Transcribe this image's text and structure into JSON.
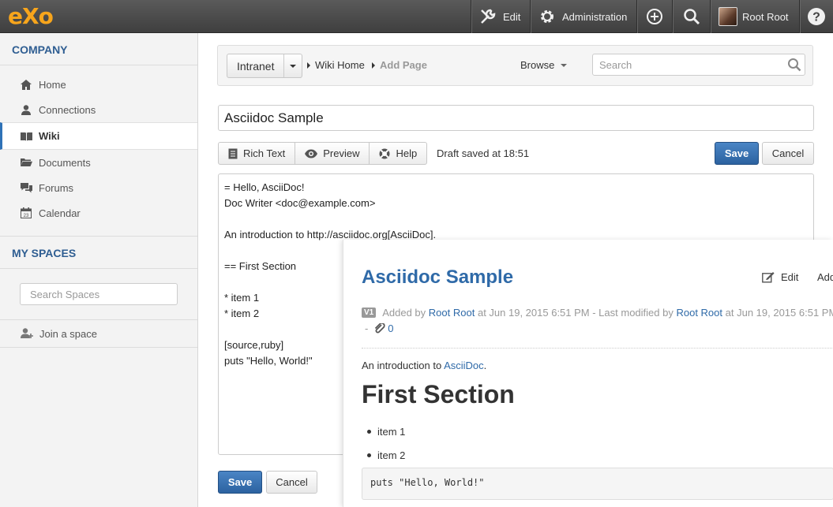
{
  "topbar": {
    "logo": "eXo",
    "edit_label": "Edit",
    "admin_label": "Administration",
    "user_name": "Root Root"
  },
  "sidebar": {
    "company_heading": "COMPANY",
    "items": [
      {
        "label": "Home",
        "icon": "home-icon"
      },
      {
        "label": "Connections",
        "icon": "user-icon"
      },
      {
        "label": "Wiki",
        "icon": "book-icon",
        "active": true
      },
      {
        "label": "Documents",
        "icon": "folder-icon"
      },
      {
        "label": "Forums",
        "icon": "chat-icon"
      },
      {
        "label": "Calendar",
        "icon": "calendar-icon"
      }
    ],
    "spaces_heading": "MY SPACES",
    "search_placeholder": "Search Spaces",
    "join_label": "Join a space"
  },
  "navbar": {
    "space": "Intranet",
    "crumb_home": "Wiki Home",
    "crumb_current": "Add Page",
    "browse_label": "Browse",
    "search_placeholder": "Search"
  },
  "editor": {
    "title_value": "Asciidoc Sample",
    "rich_text_label": "Rich Text",
    "preview_label": "Preview",
    "help_label": "Help",
    "draft_status": "Draft saved at 18:51",
    "save_label": "Save",
    "cancel_label": "Cancel",
    "lines": [
      "= Hello, AsciiDoc!",
      "Doc Writer <doc@example.com>",
      "",
      "An introduction to http://asciidoc.org[AsciiDoc].",
      "",
      "== First Section",
      "",
      "* item 1",
      "* item 2",
      "",
      "[source,ruby]",
      "puts \"Hello, World!\""
    ]
  },
  "preview": {
    "title": "Asciidoc Sample",
    "edit_label": "Edit",
    "add_label": "Add P",
    "version_badge": "V1",
    "added_by_prefix": "Added by",
    "author": "Root Root",
    "added_at": "at Jun 19, 2015 6:51 PM - Last modified by",
    "modifier": "Root Root",
    "modified_at": "at Jun 19, 2015 6:51 PM",
    "dash": "-",
    "attachments_count": "0",
    "intro_text": "An introduction to",
    "intro_link": "AsciiDoc",
    "intro_end": ".",
    "section_heading": "First Section",
    "items": [
      "item 1",
      "item 2"
    ],
    "code": "puts \"Hello, World!\""
  },
  "colors": {
    "accent": "#2f6aa8",
    "primary_button": "#2c62a0",
    "logo": "#f7a51c"
  }
}
